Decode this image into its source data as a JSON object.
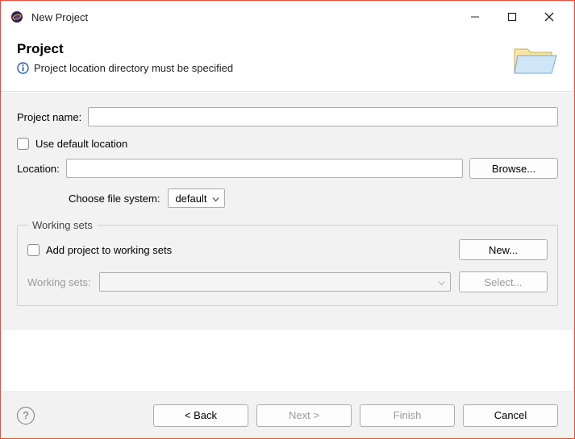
{
  "window": {
    "title": "New Project"
  },
  "banner": {
    "heading": "Project",
    "message": "Project location directory must be specified"
  },
  "form": {
    "project_name_label": "Project name:",
    "project_name_value": "",
    "use_default_location_label": "Use default location",
    "use_default_location_checked": false,
    "location_label": "Location:",
    "location_value": "",
    "browse_label": "Browse...",
    "choose_fs_label": "Choose file system:",
    "choose_fs_value": "default"
  },
  "working_sets": {
    "legend": "Working sets",
    "add_label": "Add project to working sets",
    "add_checked": false,
    "new_label": "New...",
    "sets_label": "Working sets:",
    "sets_value": "",
    "select_label": "Select..."
  },
  "buttons": {
    "back": "< Back",
    "next": "Next >",
    "finish": "Finish",
    "cancel": "Cancel"
  }
}
